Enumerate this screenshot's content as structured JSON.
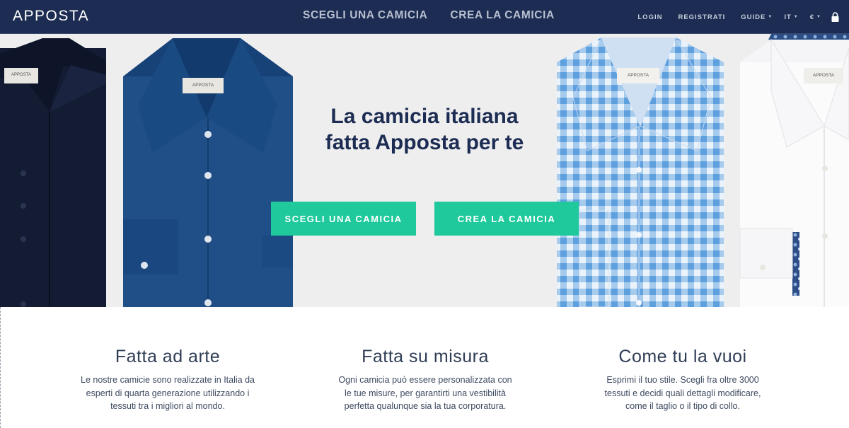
{
  "brand": {
    "logo": "APPOSTA"
  },
  "header": {
    "main_nav": [
      "SCEGLI UNA CAMICIA",
      "CREA LA CAMICIA"
    ],
    "login": "LOGIN",
    "register": "REGISTRATI",
    "guides": "GUIDE",
    "language": "IT",
    "currency": "€"
  },
  "hero": {
    "title_line1": "La camicia italiana",
    "title_line2": "fatta Apposta per te",
    "btn_choose": "SCEGLI UNA CAMICIA",
    "btn_create": "CREA LA CAMICIA",
    "label_text": "APPOSTA"
  },
  "features": [
    {
      "title": "Fatta ad arte",
      "text_lines": [
        "Le nostre camicie sono realizzate in Italia da",
        "esperti di quarta generazione utilizzando i",
        "tessuti tra i migliori al mondo."
      ]
    },
    {
      "title": "Fatta su misura",
      "text_lines": [
        "Ogni camicia può essere personalizzata con",
        "le tue misure, per garantirti una vestibilità",
        "perfetta qualunque sia la tua corporatura."
      ]
    },
    {
      "title": "Come tu la vuoi",
      "text_lines": [
        "Esprimi il tuo stile. Scegli fra oltre 3000",
        "tessuti e decidi quali dettagli modificare,",
        "come il taglio o il tipo di collo."
      ]
    }
  ],
  "colors": {
    "navbar": "#1c2c52",
    "accent": "#1fc99b",
    "hero_bg": "#eeeeef",
    "title": "#1c2c52"
  },
  "icons": {
    "cart": "lock-icon",
    "dropdown": "caret-down-icon"
  }
}
